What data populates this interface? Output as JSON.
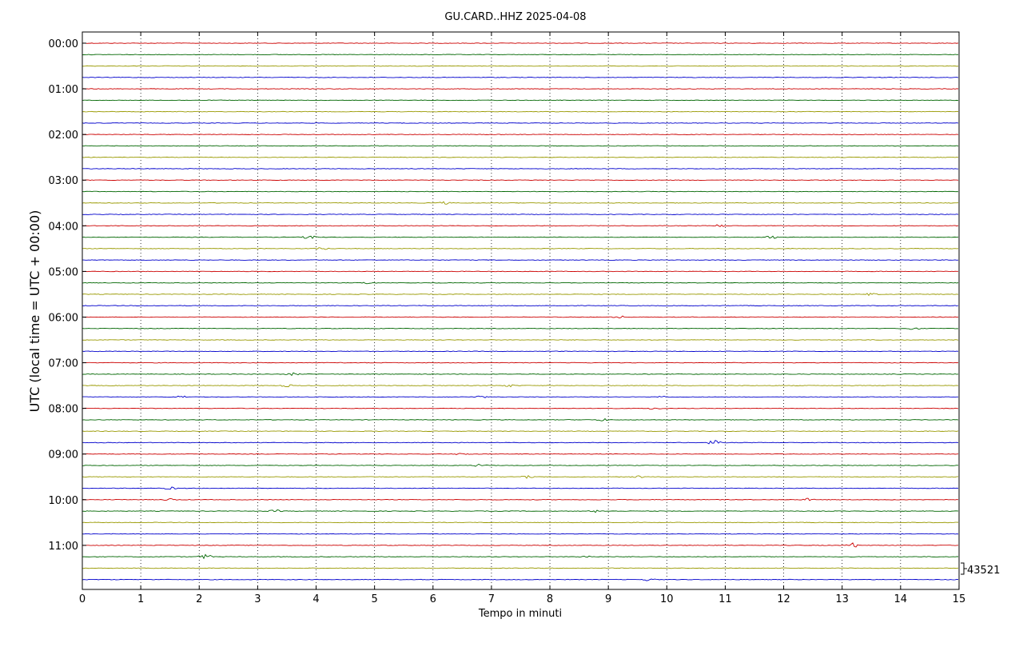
{
  "chart_data": {
    "type": "line",
    "title": "GU.CARD..HHZ 2025-04-08",
    "xlabel": "Tempo in minuti",
    "ylabel": "UTC (local time = UTC + 00:00)",
    "xlim": [
      0,
      15
    ],
    "x_ticks": [
      "0",
      "1",
      "2",
      "3",
      "4",
      "5",
      "6",
      "7",
      "8",
      "9",
      "10",
      "11",
      "12",
      "13",
      "14",
      "15"
    ],
    "y_ticks": [
      "00:00",
      "01:00",
      "02:00",
      "03:00",
      "04:00",
      "05:00",
      "06:00",
      "07:00",
      "08:00",
      "09:00",
      "10:00",
      "11:00"
    ],
    "trace_interval_minutes": 15,
    "trace_count": 48,
    "trace_colors": [
      "#cc0000",
      "#006600",
      "#999900",
      "#0000cc"
    ],
    "scale_label": "43521",
    "grid": "vertical dotted lines at each minute",
    "events": [
      {
        "trace": 14,
        "minute": 6.2,
        "amplitude": 1
      },
      {
        "trace": 16,
        "minute": 10.9,
        "amplitude": 1
      },
      {
        "trace": 17,
        "minute": 3.9,
        "amplitude": 2
      },
      {
        "trace": 17,
        "minute": 11.8,
        "amplitude": 1
      },
      {
        "trace": 18,
        "minute": 4.1,
        "amplitude": 1
      },
      {
        "trace": 21,
        "minute": 4.9,
        "amplitude": 1
      },
      {
        "trace": 22,
        "minute": 13.5,
        "amplitude": 1
      },
      {
        "trace": 24,
        "minute": 9.2,
        "amplitude": 1
      },
      {
        "trace": 25,
        "minute": 14.2,
        "amplitude": 1
      },
      {
        "trace": 29,
        "minute": 3.6,
        "amplitude": 1
      },
      {
        "trace": 30,
        "minute": 3.5,
        "amplitude": 1
      },
      {
        "trace": 30,
        "minute": 7.3,
        "amplitude": 1
      },
      {
        "trace": 31,
        "minute": 1.7,
        "amplitude": 1
      },
      {
        "trace": 31,
        "minute": 6.8,
        "amplitude": 1
      },
      {
        "trace": 31,
        "minute": 9.9,
        "amplitude": 1
      },
      {
        "trace": 32,
        "minute": 9.8,
        "amplitude": 1
      },
      {
        "trace": 33,
        "minute": 8.9,
        "amplitude": 1
      },
      {
        "trace": 35,
        "minute": 10.8,
        "amplitude": 2
      },
      {
        "trace": 36,
        "minute": 6.5,
        "amplitude": 1
      },
      {
        "trace": 37,
        "minute": 6.8,
        "amplitude": 1
      },
      {
        "trace": 38,
        "minute": 7.6,
        "amplitude": 1
      },
      {
        "trace": 38,
        "minute": 9.5,
        "amplitude": 1
      },
      {
        "trace": 39,
        "minute": 1.5,
        "amplitude": 1
      },
      {
        "trace": 40,
        "minute": 1.5,
        "amplitude": 1
      },
      {
        "trace": 40,
        "minute": 12.4,
        "amplitude": 1
      },
      {
        "trace": 41,
        "minute": 3.3,
        "amplitude": 1
      },
      {
        "trace": 41,
        "minute": 8.8,
        "amplitude": 1
      },
      {
        "trace": 44,
        "minute": 13.2,
        "amplitude": 2
      },
      {
        "trace": 45,
        "minute": 2.1,
        "amplitude": 2
      },
      {
        "trace": 45,
        "minute": 8.6,
        "amplitude": 1
      },
      {
        "trace": 47,
        "minute": 9.7,
        "amplitude": 1
      }
    ]
  }
}
